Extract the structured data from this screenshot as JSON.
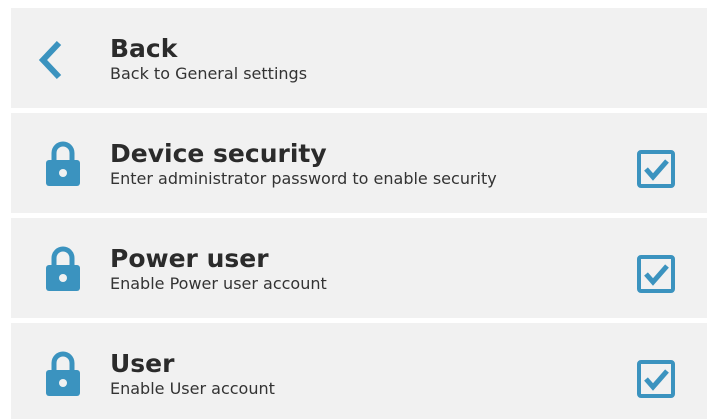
{
  "colors": {
    "accent": "#3b93bf",
    "row_background": "#f1f1f1",
    "title_text": "#2b2b2b",
    "subtitle_text": "#333333"
  },
  "back": {
    "icon": "chevron-left-icon",
    "title": "Back",
    "subtitle": "Back to General settings"
  },
  "settings": [
    {
      "icon": "lock-icon",
      "title": "Device security",
      "subtitle": "Enter administrator password to enable security",
      "checked": true
    },
    {
      "icon": "lock-icon",
      "title": "Power user",
      "subtitle": "Enable Power user account",
      "checked": true
    },
    {
      "icon": "lock-icon",
      "title": "User",
      "subtitle": "Enable User account",
      "checked": true
    }
  ]
}
